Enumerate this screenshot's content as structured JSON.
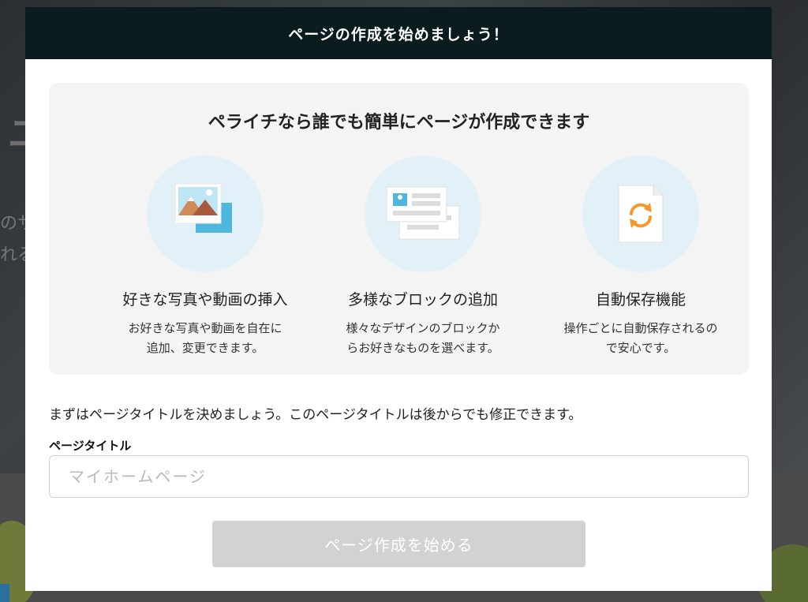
{
  "background": {
    "glyph_large": "ユ",
    "line1": "のサ",
    "line2": "れる"
  },
  "modal": {
    "header_title": "ページの作成を始めましょう！",
    "features_title": "ペライチなら誰でも簡単にページが作成できます",
    "features": [
      {
        "icon": "image-icon",
        "name": "好きな写真や動画の挿入",
        "desc_line1": "お好きな写真や動画を自在に",
        "desc_line2": "追加、変更できます。"
      },
      {
        "icon": "blocks-icon",
        "name": "多様なブロックの追加",
        "desc_line1": "様々なデザインのブロックか",
        "desc_line2": "らお好きなものを選べます。"
      },
      {
        "icon": "autosave-document-icon",
        "name": "自動保存機能",
        "desc_line1": "操作ごとに自動保存されるの",
        "desc_line2": "で安心です。"
      }
    ],
    "intro_text": "まずはページタイトルを決めましょう。このページタイトルは後からでも修正できます。",
    "title_field": {
      "label": "ページタイトル",
      "value": "",
      "placeholder": "マイホームページ"
    },
    "create_button_label": "ページ作成を始める"
  },
  "colors": {
    "header_bg": "#0b1c1e",
    "icon_circle_bg": "#e2f1f7",
    "accent_blue": "#4fb6dd",
    "accent_orange": "#f29a2e",
    "button_disabled_bg": "#d2d2d2"
  }
}
